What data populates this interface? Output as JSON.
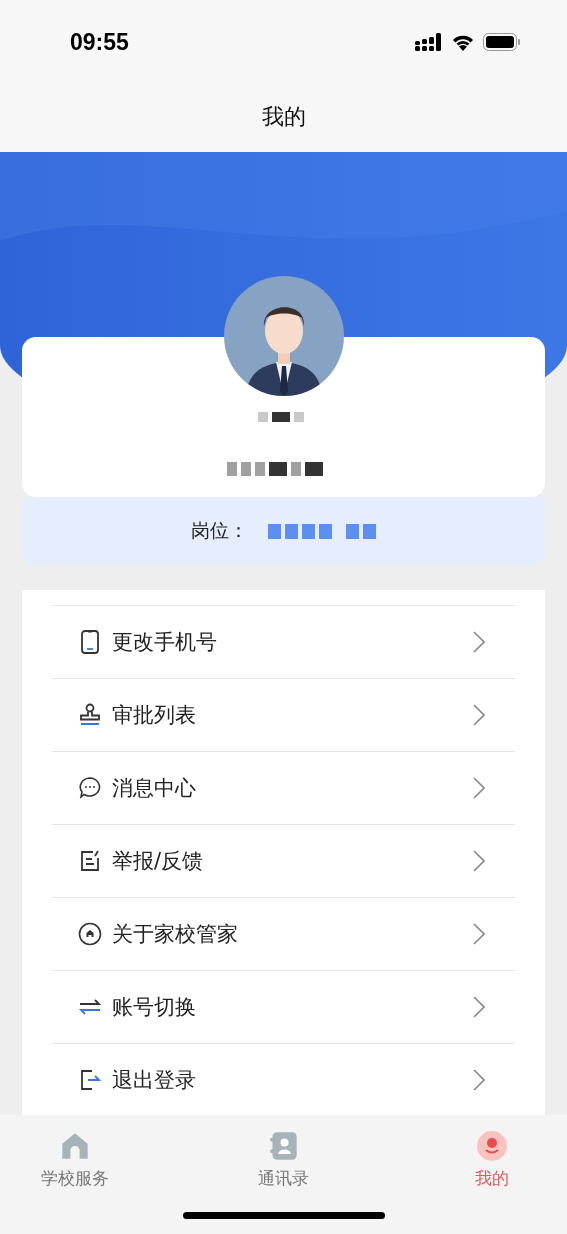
{
  "status_bar": {
    "time": "09:55"
  },
  "title": "我的",
  "profile": {
    "role_label": "岗位："
  },
  "menu": [
    {
      "kind": "phone",
      "label": "更改手机号"
    },
    {
      "kind": "stamp",
      "label": "审批列表"
    },
    {
      "kind": "chat",
      "label": "消息中心"
    },
    {
      "kind": "edit",
      "label": "举报/反馈"
    },
    {
      "kind": "home",
      "label": "关于家校管家"
    },
    {
      "kind": "switch",
      "label": "账号切换"
    },
    {
      "kind": "logout",
      "label": "退出登录"
    }
  ],
  "tabs": [
    {
      "kind": "home",
      "label": "学校服务",
      "selected": false
    },
    {
      "kind": "contacts",
      "label": "通讯录",
      "selected": false
    },
    {
      "kind": "me",
      "label": "我的",
      "selected": true
    }
  ]
}
